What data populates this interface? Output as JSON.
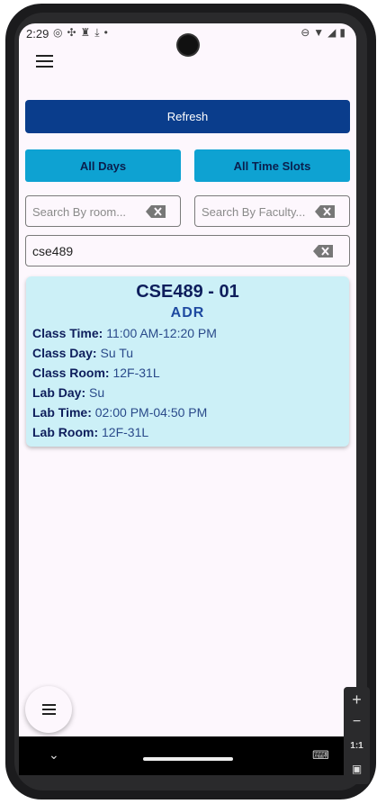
{
  "status_bar": {
    "time": "2:29",
    "left_icons": [
      "instagram-icon",
      "fan-icon",
      "bell-icon",
      "download-icon",
      "dot-icon"
    ],
    "right_icons": [
      "dnd-icon",
      "wifi-icon",
      "signal-icon",
      "battery-icon"
    ]
  },
  "toolbar": {
    "menu_icon": "hamburger-menu-icon"
  },
  "actions": {
    "refresh_label": "Refresh",
    "all_days_label": "All Days",
    "all_time_slots_label": "All Time Slots"
  },
  "search": {
    "room_placeholder": "Search By room...",
    "faculty_placeholder": "Search By Faculty...",
    "course_value": "cse489"
  },
  "result_card": {
    "title": "CSE489 - 01",
    "faculty": "ADR",
    "rows": [
      {
        "label": "Class Time:",
        "value": "11:00 AM-12:20 PM"
      },
      {
        "label": "Class Day:",
        "value": "Su Tu"
      },
      {
        "label": "Class Room:",
        "value": "12F-31L"
      },
      {
        "label": "Lab Day:",
        "value": "Su"
      },
      {
        "label": "Lab Time:",
        "value": "02:00 PM-04:50 PM"
      },
      {
        "label": "Lab Room:",
        "value": "12F-31L"
      }
    ]
  },
  "fab": {
    "icon": "menu-icon"
  },
  "emulator_panel": {
    "zoom_ratio": "1:1"
  },
  "colors": {
    "primary": "#0a3d8c",
    "filter_button": "#0ea2d2",
    "card_background": "#ccf0f7",
    "card_title": "#0e1e5c"
  }
}
